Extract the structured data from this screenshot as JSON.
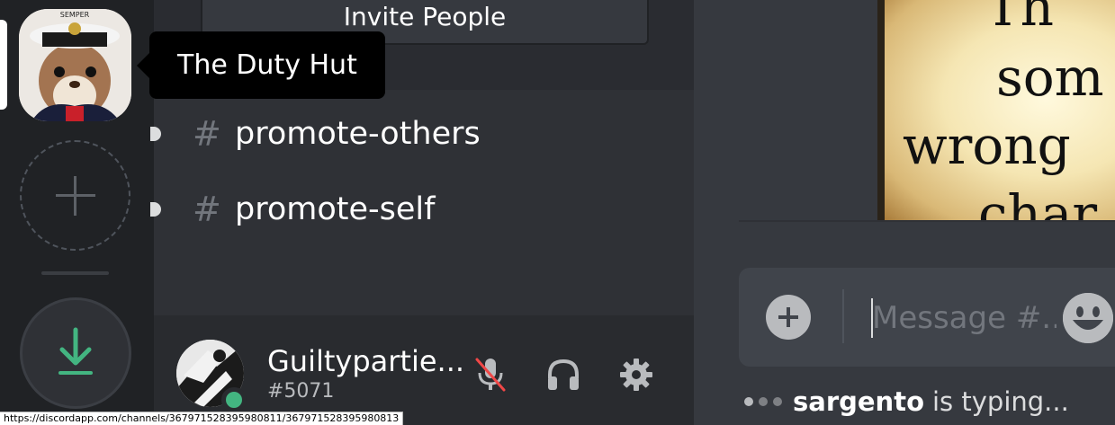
{
  "server_rail": {
    "server_name": "The Duty Hut",
    "add_server_icon": "plus-icon",
    "download_icon": "download-arrow-icon"
  },
  "channel_list": {
    "invite_label": "Invite People",
    "channels": [
      {
        "hash": "#",
        "name": "promote-others"
      },
      {
        "hash": "#",
        "name": "promote-self"
      }
    ]
  },
  "user_panel": {
    "username": "Guiltypartie...",
    "discriminator": "#5071",
    "status_color": "#43b581",
    "mute_icon": "microphone-muted-icon",
    "deafen_icon": "headphones-icon",
    "settings_icon": "gear-icon"
  },
  "chat": {
    "image_lines": [
      "Th",
      "som",
      "wrong",
      "char"
    ],
    "composer": {
      "placeholder": "Message #...",
      "add_icon": "plus-circle-icon",
      "emoji_icon": "smiley-emoji-icon"
    },
    "typing_user": "sargento",
    "typing_text": "is typing..."
  },
  "status_url": "https://discordapp.com/channels/367971528395980811/367971528395980813"
}
